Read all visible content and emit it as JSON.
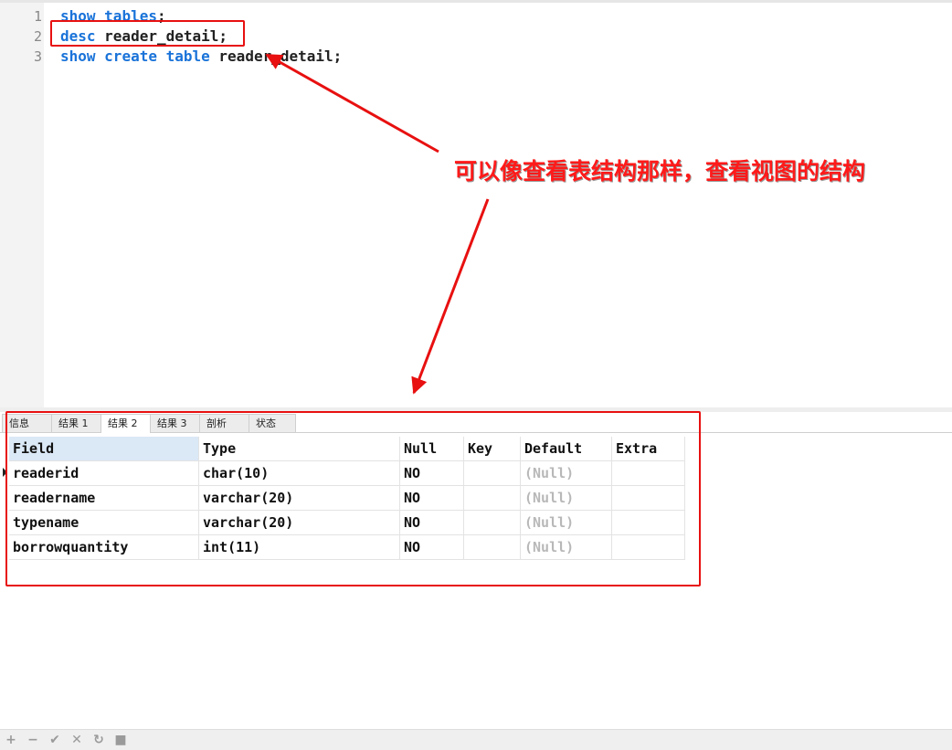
{
  "editor": {
    "lines": [
      {
        "num": "1",
        "parts": [
          {
            "t": "show",
            "kw": true
          },
          {
            "t": " "
          },
          {
            "t": "tables",
            "kw": true
          },
          {
            "t": ";"
          }
        ]
      },
      {
        "num": "2",
        "parts": [
          {
            "t": "desc",
            "kw": true
          },
          {
            "t": " reader_detail;"
          }
        ]
      },
      {
        "num": "3",
        "parts": [
          {
            "t": "show",
            "kw": true
          },
          {
            "t": " "
          },
          {
            "t": "create",
            "kw": true
          },
          {
            "t": " "
          },
          {
            "t": "table",
            "kw": true
          },
          {
            "t": " reader_detail;"
          }
        ]
      }
    ]
  },
  "annotation": {
    "note": "可以像查看表结构那样，查看视图的结构",
    "color": "#e81010"
  },
  "tabs": [
    {
      "label": "信息"
    },
    {
      "label": "结果 1"
    },
    {
      "label": "结果 2",
      "active": true
    },
    {
      "label": "结果 3"
    },
    {
      "label": "剖析"
    },
    {
      "label": "状态"
    }
  ],
  "results": {
    "columns": [
      "Field",
      "Type",
      "Null",
      "Key",
      "Default",
      "Extra"
    ],
    "rows": [
      [
        "readerid",
        "char(10)",
        "NO",
        "",
        "(Null)",
        ""
      ],
      [
        "readername",
        "varchar(20)",
        "NO",
        "",
        "(Null)",
        ""
      ],
      [
        "typename",
        "varchar(20)",
        "NO",
        "",
        "(Null)",
        ""
      ],
      [
        "borrowquantity",
        "int(11)",
        "NO",
        "",
        "(Null)",
        ""
      ]
    ],
    "null_color": "#b8b8b8",
    "header_selected_color": "#dbe8f6"
  },
  "toolbar": {
    "buttons": [
      {
        "icon": "plus-icon",
        "glyph": "+"
      },
      {
        "icon": "minus-icon",
        "glyph": "−"
      },
      {
        "icon": "check-icon",
        "glyph": "✔"
      },
      {
        "icon": "close-icon",
        "glyph": "✕"
      },
      {
        "icon": "refresh-icon",
        "glyph": "↻"
      },
      {
        "icon": "stop-icon",
        "glyph": "■"
      }
    ]
  },
  "colors": {
    "keyword": "#1a73d9",
    "gutter": "#f3f3f3"
  }
}
